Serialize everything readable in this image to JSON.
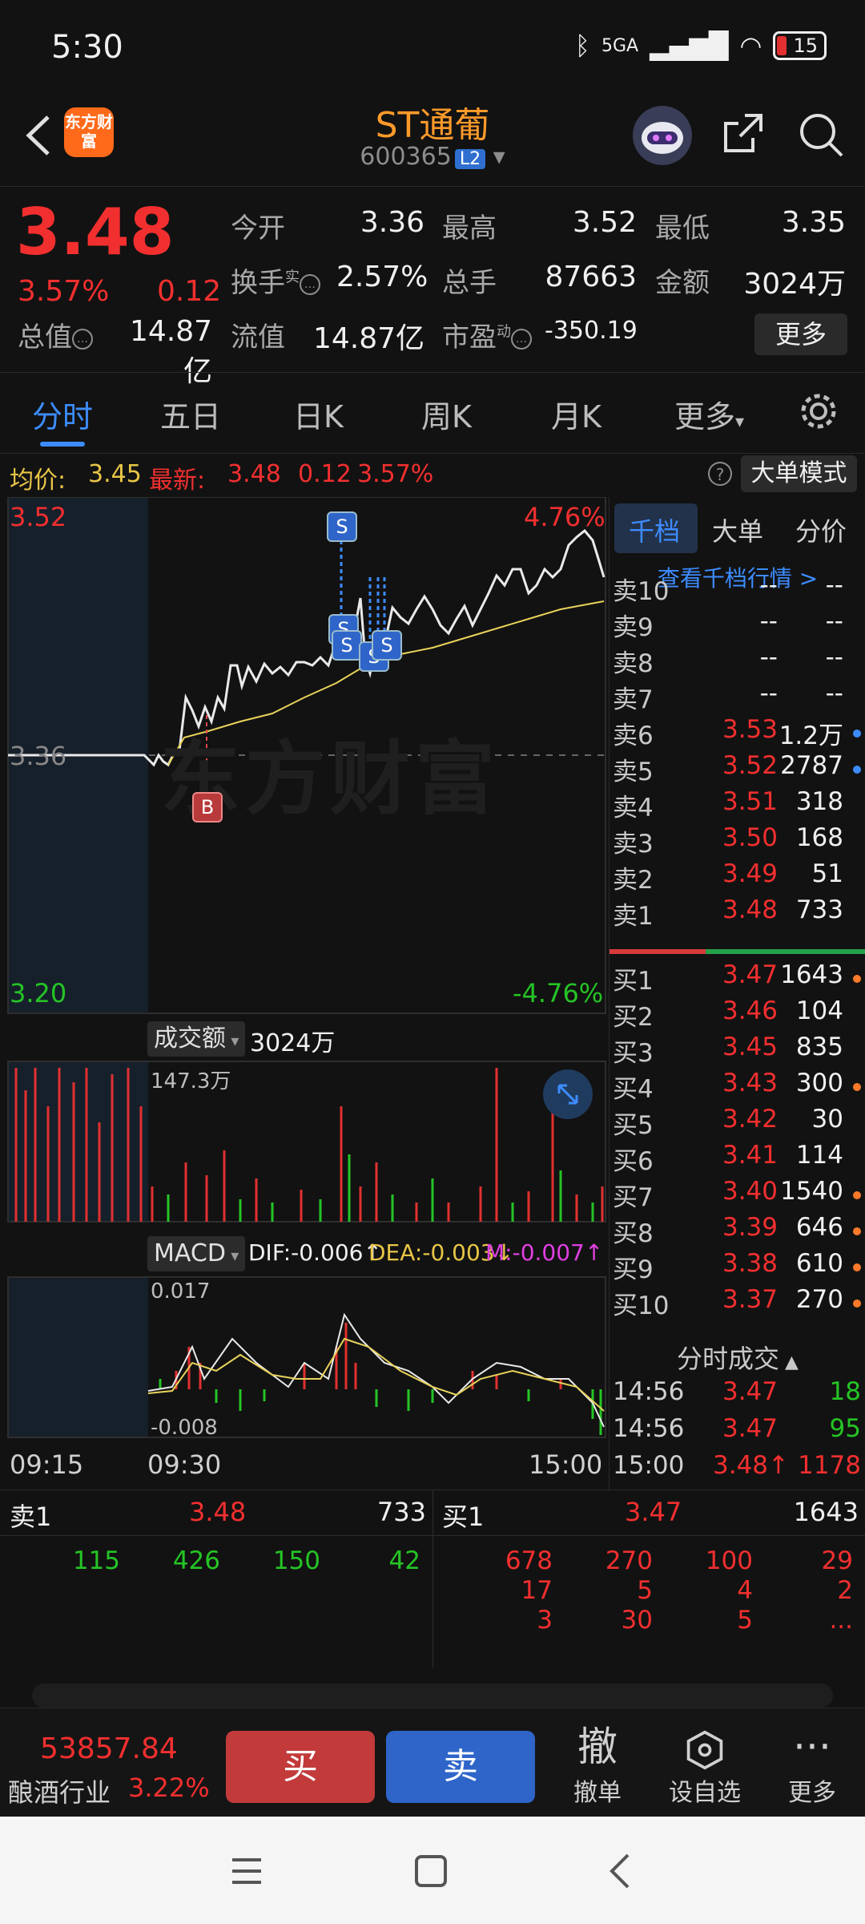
{
  "status": {
    "time": "5:30",
    "network": "5GA",
    "battery": "15"
  },
  "header": {
    "logo": "东方财富",
    "name": "ST通葡",
    "code": "600365",
    "level": "L2"
  },
  "quote": {
    "price": "3.48",
    "pct": "3.57%",
    "change": "0.12",
    "fields": {
      "open_label": "今开",
      "open": "3.36",
      "high_label": "最高",
      "high": "3.52",
      "low_label": "最低",
      "low": "3.35",
      "turnover_label": "换手",
      "turnover_sup": "实",
      "turnover": "2.57%",
      "volume_label": "总手",
      "volume": "87663",
      "amount_label": "金额",
      "amount": "3024万",
      "mcap_label": "总值",
      "mcap": "14.87亿",
      "float_label": "流值",
      "float": "14.87亿",
      "pe_label": "市盈",
      "pe_sup": "动",
      "pe": "-350.19"
    },
    "more": "更多"
  },
  "tabs": [
    "分时",
    "五日",
    "日K",
    "周K",
    "月K",
    "更多"
  ],
  "avg": {
    "avg_label": "均价:",
    "avg": "3.45",
    "latest_label": "最新:",
    "latest": "3.48",
    "chg": "0.12",
    "pct": "3.57%",
    "mode_btn": "大单模式"
  },
  "chart": {
    "price_top": "3.52",
    "price_mid": "3.36",
    "price_bot": "3.20",
    "pct_top": "4.76%",
    "pct_bot": "-4.76%",
    "vol_label": "成交额",
    "vol_total": "3024万",
    "vol_max": "147.3万",
    "macd_label": "MACD",
    "dif": "DIF:-0.006↑",
    "dea": "DEA:-0.003↓",
    "m": "M:-0.007↑",
    "macd_top": "0.017",
    "macd_bot": "-0.008",
    "t1": "09:15",
    "t2": "09:30",
    "t3": "15:00",
    "watermark": "东方财富",
    "marker_b": "B",
    "marker_s": "S"
  },
  "book": {
    "tabs": [
      "千档",
      "大单",
      "分价"
    ],
    "view_link": "查看千档行情 >",
    "asks": [
      {
        "label": "卖10",
        "price": "--",
        "vol": "--"
      },
      {
        "label": "卖9",
        "price": "--",
        "vol": "--"
      },
      {
        "label": "卖8",
        "price": "--",
        "vol": "--"
      },
      {
        "label": "卖7",
        "price": "--",
        "vol": "--"
      },
      {
        "label": "卖6",
        "price": "3.53",
        "vol": "1.2万"
      },
      {
        "label": "卖5",
        "price": "3.52",
        "vol": "2787"
      },
      {
        "label": "卖4",
        "price": "3.51",
        "vol": "318"
      },
      {
        "label": "卖3",
        "price": "3.50",
        "vol": "168"
      },
      {
        "label": "卖2",
        "price": "3.49",
        "vol": "51"
      },
      {
        "label": "卖1",
        "price": "3.48",
        "vol": "733"
      }
    ],
    "bids": [
      {
        "label": "买1",
        "price": "3.47",
        "vol": "1643"
      },
      {
        "label": "买2",
        "price": "3.46",
        "vol": "104"
      },
      {
        "label": "买3",
        "price": "3.45",
        "vol": "835"
      },
      {
        "label": "买4",
        "price": "3.43",
        "vol": "300"
      },
      {
        "label": "买5",
        "price": "3.42",
        "vol": "30"
      },
      {
        "label": "买6",
        "price": "3.41",
        "vol": "114"
      },
      {
        "label": "买7",
        "price": "3.40",
        "vol": "1540"
      },
      {
        "label": "买8",
        "price": "3.39",
        "vol": "646"
      },
      {
        "label": "买9",
        "price": "3.38",
        "vol": "610"
      },
      {
        "label": "买10",
        "price": "3.37",
        "vol": "270"
      }
    ],
    "ticks_title": "分时成交",
    "ticks": [
      {
        "time": "14:56",
        "price": "3.47",
        "vol": "18"
      },
      {
        "time": "14:56",
        "price": "3.47",
        "vol": "95"
      },
      {
        "time": "15:00",
        "price": "3.48↑",
        "vol": "1178"
      }
    ]
  },
  "queue": {
    "sell_label": "卖1",
    "sell_price": "3.48",
    "sell_vol": "733",
    "buy_label": "买1",
    "buy_price": "3.47",
    "buy_vol": "1643",
    "sell_orders": [
      "115",
      "426",
      "150",
      "42"
    ],
    "buy_orders": [
      "678",
      "270",
      "100",
      "29",
      "17",
      "5",
      "4",
      "2",
      "3",
      "30",
      "5",
      "..."
    ]
  },
  "tradebar": {
    "index_value": "53857.84",
    "index_name": "酿酒行业",
    "index_pct": "3.22%",
    "buy": "买",
    "sell": "卖",
    "cancel_icon": "撤",
    "cancel": "撤单",
    "watch": "设自选",
    "more": "更多"
  }
}
